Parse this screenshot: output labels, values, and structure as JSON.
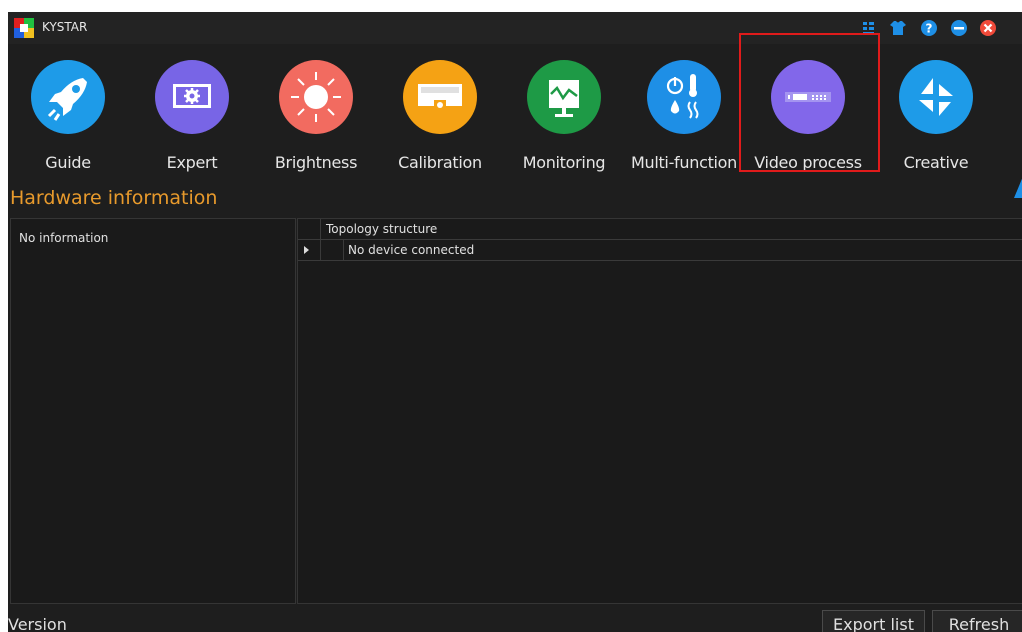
{
  "window": {
    "title": "KYSTAR",
    "controls": [
      {
        "icon": "layout-icon"
      },
      {
        "icon": "skin-icon"
      },
      {
        "icon": "help-icon"
      },
      {
        "icon": "minimize-icon"
      },
      {
        "icon": "close-icon"
      }
    ]
  },
  "toolbar": {
    "items": [
      {
        "label": "Guide",
        "color": "#1e9be8",
        "icon": "rocket-icon"
      },
      {
        "label": "Expert",
        "color": "#7865e6",
        "icon": "gear-screen-icon"
      },
      {
        "label": "Brightness",
        "color": "#f26b60",
        "icon": "sun-icon"
      },
      {
        "label": "Calibration",
        "color": "#f5a214",
        "icon": "camera-screen-icon"
      },
      {
        "label": "Monitoring",
        "color": "#1e9a46",
        "icon": "monitor-graph-icon"
      },
      {
        "label": "Multi-function",
        "color": "#1e8fe6",
        "icon": "multi-function-icon"
      },
      {
        "label": "Video process",
        "color": "#8267ea",
        "icon": "video-processor-icon"
      },
      {
        "label": "Creative",
        "color": "#1e9be8",
        "icon": "creative-icon"
      }
    ]
  },
  "hardware": {
    "title": "Hardware information",
    "left_text": "No information",
    "table_header": "Topology structure",
    "row_text": "No device connected"
  },
  "footer": {
    "version_label": "Version",
    "export_label": "Export list",
    "refresh_label": "Refresh"
  },
  "colors": {
    "accent": "#e89a2c",
    "highlight": "#e01b1b",
    "background": "#1e1e1e"
  }
}
